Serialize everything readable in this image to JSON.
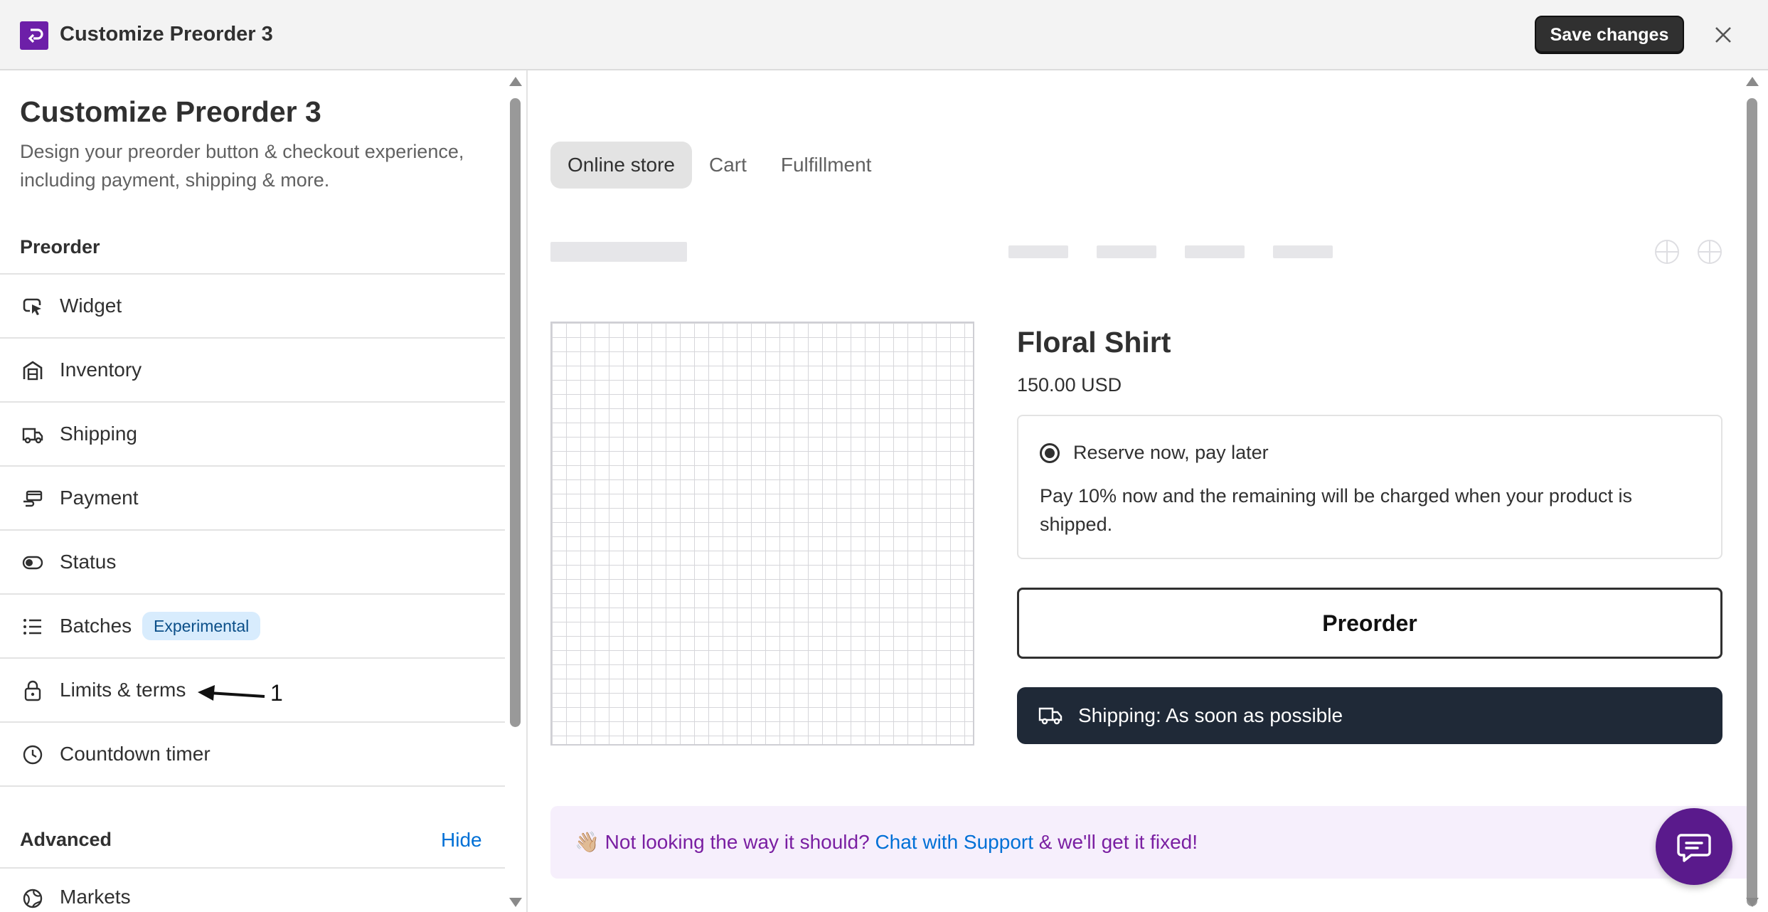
{
  "window": {
    "title": "Customize Preorder 3",
    "save_label": "Save changes",
    "logo_icon": "app-logo-icon",
    "close_icon": "close-icon"
  },
  "sidebar": {
    "title": "Customize Preorder 3",
    "description": "Design your preorder button & checkout experience, including payment, shipping & more.",
    "section_preorder": "Preorder",
    "items": [
      {
        "label": "Widget",
        "icon": "cursor-icon"
      },
      {
        "label": "Inventory",
        "icon": "warehouse-icon"
      },
      {
        "label": "Shipping",
        "icon": "truck-icon"
      },
      {
        "label": "Payment",
        "icon": "payment-hand-icon"
      },
      {
        "label": "Status",
        "icon": "toggle-icon"
      },
      {
        "label": "Batches",
        "icon": "list-icon",
        "badge": "Experimental"
      },
      {
        "label": "Limits & terms",
        "icon": "lock-icon"
      },
      {
        "label": "Countdown timer",
        "icon": "clock-icon"
      }
    ],
    "section_advanced": "Advanced",
    "hide_label": "Hide",
    "markets_label": "Markets",
    "markets_icon": "globe-icon"
  },
  "annotation": {
    "label": "1"
  },
  "preview": {
    "tabs": [
      {
        "label": "Online store",
        "active": true
      },
      {
        "label": "Cart",
        "active": false
      },
      {
        "label": "Fulfillment",
        "active": false
      }
    ],
    "product": {
      "title": "Floral Shirt",
      "price": "150.00 USD",
      "option_title": "Reserve now, pay later",
      "option_description": "Pay 10% now and the remaining will be charged when your product is shipped.",
      "preorder_label": "Preorder",
      "shipping_label": "Shipping: As soon as possible"
    },
    "support": {
      "emoji": "👋🏼",
      "prefix": "Not looking the way it should?",
      "link": "Chat with Support",
      "suffix": "& we'll get it fixed!"
    }
  },
  "colors": {
    "brand": "#6d1fa8",
    "save_button": "#303030",
    "shipping_bar": "#1f2937",
    "badge_bg": "#d8ecfd",
    "link": "#0070d6",
    "support_bg": "#f6effc",
    "chat_fab": "#5a1a8c"
  }
}
